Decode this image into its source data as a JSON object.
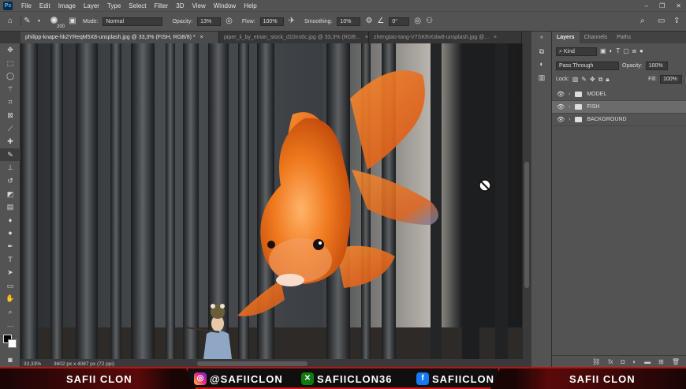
{
  "app": {
    "logo": "Ps"
  },
  "menu": [
    "File",
    "Edit",
    "Image",
    "Layer",
    "Type",
    "Select",
    "Filter",
    "3D",
    "View",
    "Window",
    "Help"
  ],
  "window_controls": {
    "minimize": "–",
    "restore": "❐",
    "close": "✕"
  },
  "options": {
    "brush_size": "200",
    "mode_label": "Mode:",
    "mode_value": "Normal",
    "opacity_label": "Opacity:",
    "opacity_value": "13%",
    "flow_label": "Flow:",
    "flow_value": "100%",
    "smoothing_label": "Smoothing:",
    "smoothing_value": "10%",
    "angle_value": "0°"
  },
  "tabs": [
    {
      "label": "philipp-knape-hk2YReqM5X8-unsplash.jpg @ 33,3% (FISH, RGB/8) *",
      "close": "×"
    },
    {
      "label": "piper_ii_by_eirian_stock_d10ns6c.jpg @ 33,3% (RGB...",
      "close": "×"
    },
    {
      "label": "zhengtao-tang-V7SKIhXslw8-unsplash.jpg @...",
      "close": "×"
    }
  ],
  "status": {
    "zoom": "33,33%",
    "dims": "3602 px x 4087 px (72 ppi)"
  },
  "panel": {
    "tabs": [
      "Layers",
      "Channels",
      "Paths"
    ],
    "kind_label": "Kind",
    "blend_mode": "Pass Through",
    "opacity_label": "Opacity:",
    "opacity_value": "100%",
    "lock_label": "Lock:",
    "fill_label": "Fill:",
    "fill_value": "100%",
    "layers": [
      {
        "name": "MODEL",
        "selected": false
      },
      {
        "name": "FISH",
        "selected": true
      },
      {
        "name": "BACKGROUND",
        "selected": false
      }
    ],
    "footer_icons": [
      "link-icon",
      "fx-icon",
      "mask-icon",
      "adjustment-icon",
      "group-icon",
      "new-layer-icon",
      "trash-icon"
    ]
  },
  "banner": {
    "left_name": "SAFII CLON",
    "instagram": "@SAFIICLON",
    "xbox": "SAFIICLON36",
    "facebook": "SAFIICLON",
    "right_name": "SAFII CLON"
  },
  "colors": {
    "accent": "#d01414",
    "instagram": "#c13584",
    "xbox": "#107c10",
    "facebook": "#1877f2",
    "fish": "#f07a1e"
  }
}
